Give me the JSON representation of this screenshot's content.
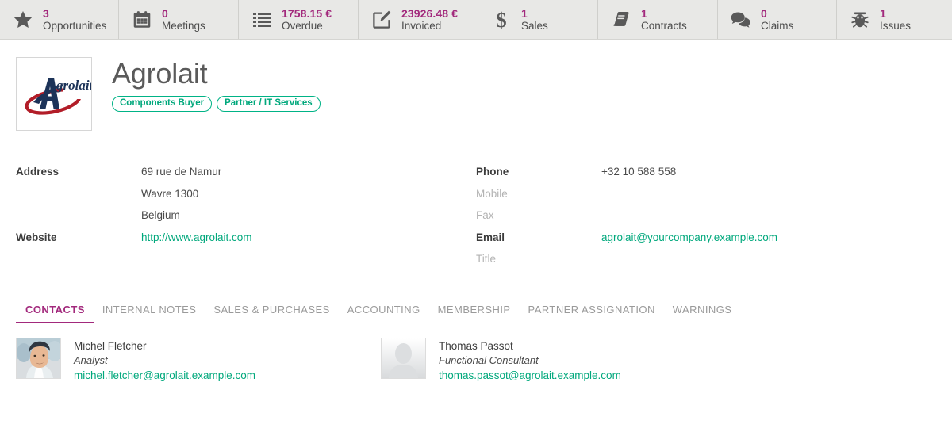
{
  "colors": {
    "accent_magenta": "#a2297c",
    "accent_green": "#00a87c",
    "statbar_bg": "#e8e8e6",
    "icon_gray": "#595959"
  },
  "statbar": {
    "items": [
      {
        "icon": "star-icon",
        "value": "3",
        "label": "Opportunities"
      },
      {
        "icon": "calendar-icon",
        "value": "0",
        "label": "Meetings"
      },
      {
        "icon": "list-icon",
        "value": "1758.15 €",
        "label": "Overdue"
      },
      {
        "icon": "invoice-pencil-icon",
        "value": "23926.48 €",
        "label": "Invoiced"
      },
      {
        "icon": "dollar-icon",
        "value": "1",
        "label": "Sales"
      },
      {
        "icon": "book-icon",
        "value": "1",
        "label": "Contracts"
      },
      {
        "icon": "speech-bubbles-icon",
        "value": "0",
        "label": "Claims"
      },
      {
        "icon": "bug-icon",
        "value": "1",
        "label": "Issues"
      }
    ]
  },
  "record": {
    "logo_alt": "Agrolait logo",
    "title": "Agrolait",
    "tags": [
      "Components Buyer",
      "Partner / IT Services"
    ],
    "left_fields": [
      {
        "label": "Address",
        "value": "69 rue de Namur",
        "type": "text",
        "empty": false
      },
      {
        "label": "",
        "value": "Wavre  1300",
        "type": "text",
        "empty": false
      },
      {
        "label": "",
        "value": "Belgium",
        "type": "text",
        "empty": false
      },
      {
        "label": "Website",
        "value": "http://www.agrolait.com",
        "type": "link",
        "empty": false
      }
    ],
    "right_fields": [
      {
        "label": "Phone",
        "value": "+32 10 588 558",
        "type": "text",
        "empty": false
      },
      {
        "label": "Mobile",
        "value": "",
        "type": "text",
        "empty": true
      },
      {
        "label": "Fax",
        "value": "",
        "type": "text",
        "empty": true
      },
      {
        "label": "Email",
        "value": "agrolait@yourcompany.example.com",
        "type": "link",
        "empty": false
      },
      {
        "label": "Title",
        "value": "",
        "type": "text",
        "empty": true
      }
    ]
  },
  "tabs": {
    "items": [
      {
        "label": "CONTACTS",
        "active": true
      },
      {
        "label": "INTERNAL NOTES",
        "active": false
      },
      {
        "label": "SALES & PURCHASES",
        "active": false
      },
      {
        "label": "ACCOUNTING",
        "active": false
      },
      {
        "label": "MEMBERSHIP",
        "active": false
      },
      {
        "label": "PARTNER ASSIGNATION",
        "active": false
      },
      {
        "label": "WARNINGS",
        "active": false
      }
    ]
  },
  "contacts": {
    "items": [
      {
        "avatar": "photo-avatar-male",
        "name": "Michel Fletcher",
        "function": "Analyst",
        "email": "michel.fletcher@agrolait.example.com"
      },
      {
        "avatar": "placeholder-avatar",
        "name": "Thomas Passot",
        "function": "Functional Consultant",
        "email": "thomas.passot@agrolait.example.com"
      }
    ]
  }
}
